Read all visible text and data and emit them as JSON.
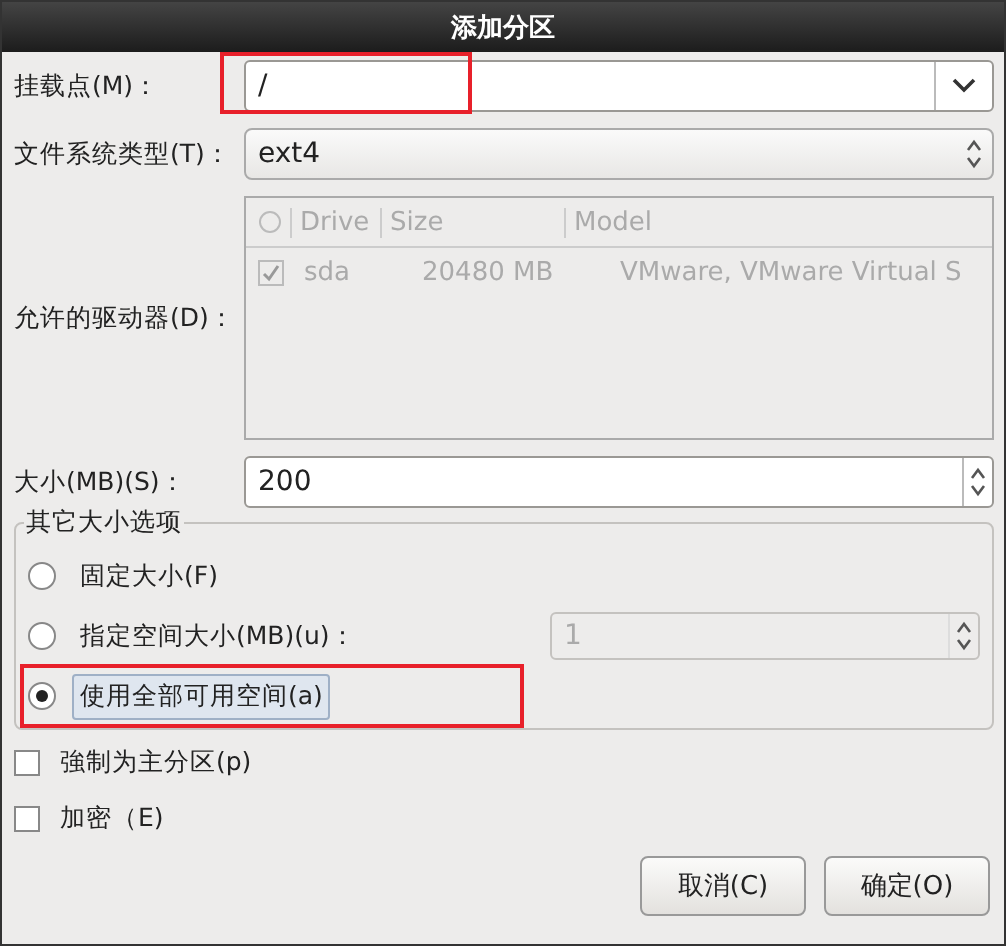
{
  "window": {
    "title": "添加分区"
  },
  "mount_point": {
    "label": "挂载点(M)：",
    "value": "/",
    "annotated": true
  },
  "fs_type": {
    "label": "文件系统类型(T)：",
    "value": "ext4"
  },
  "drives": {
    "label": "允许的驱动器(D)：",
    "disabled": true,
    "columns": [
      "Drive",
      "Size",
      "Model"
    ],
    "rows": [
      {
        "checked": true,
        "cells": [
          "sda",
          "20480 MB",
          "VMware, VMware Virtual S"
        ]
      }
    ]
  },
  "size": {
    "label": "大小(MB)(S)：",
    "value": "200"
  },
  "size_options": {
    "title": "其它大小选项",
    "options": [
      {
        "label": "固定大小(F)",
        "selected": false,
        "annotated": false
      },
      {
        "label": "指定空间大小(MB)(u)：",
        "selected": false,
        "annotated": false,
        "field": {
          "value": "1",
          "disabled": true
        }
      },
      {
        "label": "使用全部可用空间(a)",
        "selected": true,
        "annotated": true
      }
    ]
  },
  "checkboxes": [
    {
      "label": "強制为主分区(p)",
      "checked": false
    },
    {
      "label": "加密（E)",
      "checked": false
    }
  ],
  "buttons": [
    "取消(C)",
    "确定(O)"
  ]
}
